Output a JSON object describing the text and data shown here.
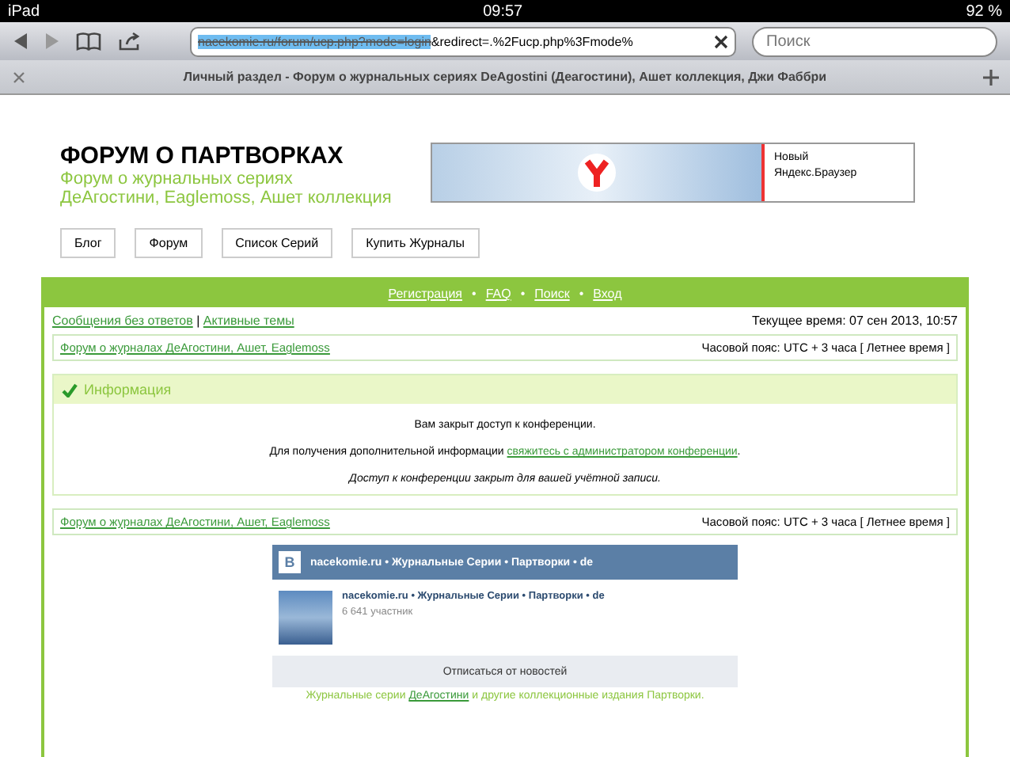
{
  "status_bar": {
    "device": "iPad",
    "time": "09:57",
    "battery": "92 %"
  },
  "toolbar": {
    "url_highlighted": "nacekomie.ru/forum/ucp.php?mode=login",
    "url_rest": "&redirect=.%2Fucp.php%3Fmode%",
    "search": {
      "placeholder": "Поиск"
    }
  },
  "tab": {
    "title": "Личный раздел - Форум о журнальных сериях DeAgostini (Деагостини), Ашет коллекция, Джи Фаббри"
  },
  "header": {
    "title": "ФОРУМ О ПАРТВОРКАХ",
    "subtitle_lines": [
      "Форум о журнальных сериях",
      "ДеАгостини, Eaglemoss, Ашет коллекция"
    ],
    "ad": {
      "lines": [
        "Новый",
        "Яндекс.Браузер"
      ]
    }
  },
  "menu": [
    "Блог",
    "Форум",
    "Список Серий",
    "Купить Журналы"
  ],
  "navbar": [
    "Регистрация",
    "FAQ",
    "Поиск",
    "Вход"
  ],
  "navbar_separator": "•",
  "quick_links": [
    "Сообщения без ответов",
    "Активные темы"
  ],
  "quick_links_separator": "|",
  "current_time": "Текущее время: 07 сен 2013, 10:57",
  "breadcrumbs": [
    {
      "link": "Форум о журналах ДеАгостини, Ашет, Eaglemoss",
      "timezone": "Часовой пояс: UTC + 3 часа [ Летнее время ]"
    },
    {
      "link": "Форум о журналах ДеАгостини, Ашет, Eaglemoss",
      "timezone": "Часовой пояс: UTC + 3 часа [ Летнее время ]"
    }
  ],
  "info": {
    "title": "Информация",
    "message": "Вам закрыт доступ к конференции.",
    "contact_before": "Для получения дополнительной информации",
    "contact_link": "свяжитесь с администратором конференции",
    "contact_after": ".",
    "note": "Доступ к конференции закрыт для вашей учётной записи."
  },
  "widget": {
    "logo": "B",
    "header": "nacekomie.ru • Журнальные Серии • Партворки • de",
    "group_name": "nacekomie.ru • Журнальные Серии • Партворки • de",
    "members": "6 641 участник",
    "button": "Отписаться от новостей"
  },
  "footer": {
    "before": "Журнальные серии",
    "link": "ДеАгостини",
    "after": "и другие коллекционные издания Партворки."
  }
}
